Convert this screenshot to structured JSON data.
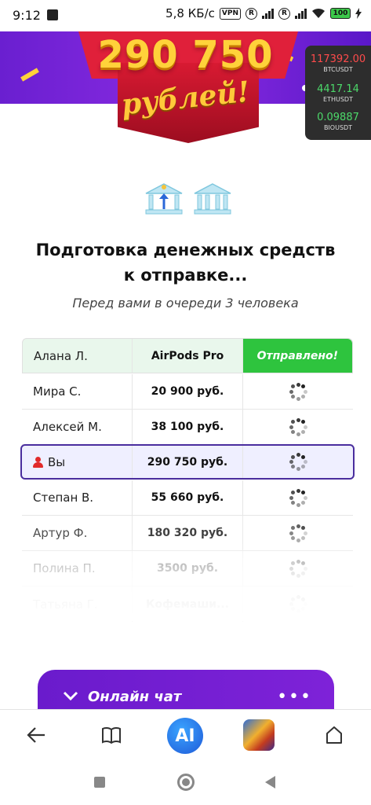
{
  "status_bar": {
    "time": "9:12",
    "speed": "5,8 КБ/с",
    "vpn": "VPN",
    "roaming": "R",
    "battery": "100"
  },
  "banner": {
    "amount": "290 750",
    "currency_script": "рублей!"
  },
  "crypto_widget": [
    {
      "value": "117392.00",
      "symbol": "BTCUSDT",
      "color": "#ff4b4b"
    },
    {
      "value": "4417.14",
      "symbol": "ETHUSDT",
      "color": "#4cd96a"
    },
    {
      "value": "0.09887",
      "symbol": "BIOUSDT",
      "color": "#4cd96a"
    }
  ],
  "main": {
    "title_line1": "Подготовка денежных средств",
    "title_line2": "к отправке...",
    "subtitle": "Перед вами в очереди 3 человека"
  },
  "queue": {
    "header": {
      "name": "Алана Л.",
      "prize": "AirPods Pro",
      "status": "Отправлено!"
    },
    "rows": [
      {
        "name": "Мира С.",
        "amount": "20 900 руб."
      },
      {
        "name": "Алексей М.",
        "amount": "38 100 руб."
      },
      {
        "name": "Вы",
        "amount": "290 750 руб."
      },
      {
        "name": "Степан В.",
        "amount": "55 660 руб."
      },
      {
        "name": "Артур Ф.",
        "amount": "180 320 руб."
      },
      {
        "name": "Полина П.",
        "amount": "3500 руб."
      },
      {
        "name": "Татьяна Г.",
        "amount": "Кофемаши..."
      }
    ]
  },
  "chat": {
    "title": "Онлайн чат",
    "more": "•••"
  },
  "browser_nav": {
    "ai_label": "AI"
  },
  "colors": {
    "accent_purple": "#6a1fd0",
    "sent_green": "#2ec43e",
    "you_border": "#4a2e9e"
  }
}
